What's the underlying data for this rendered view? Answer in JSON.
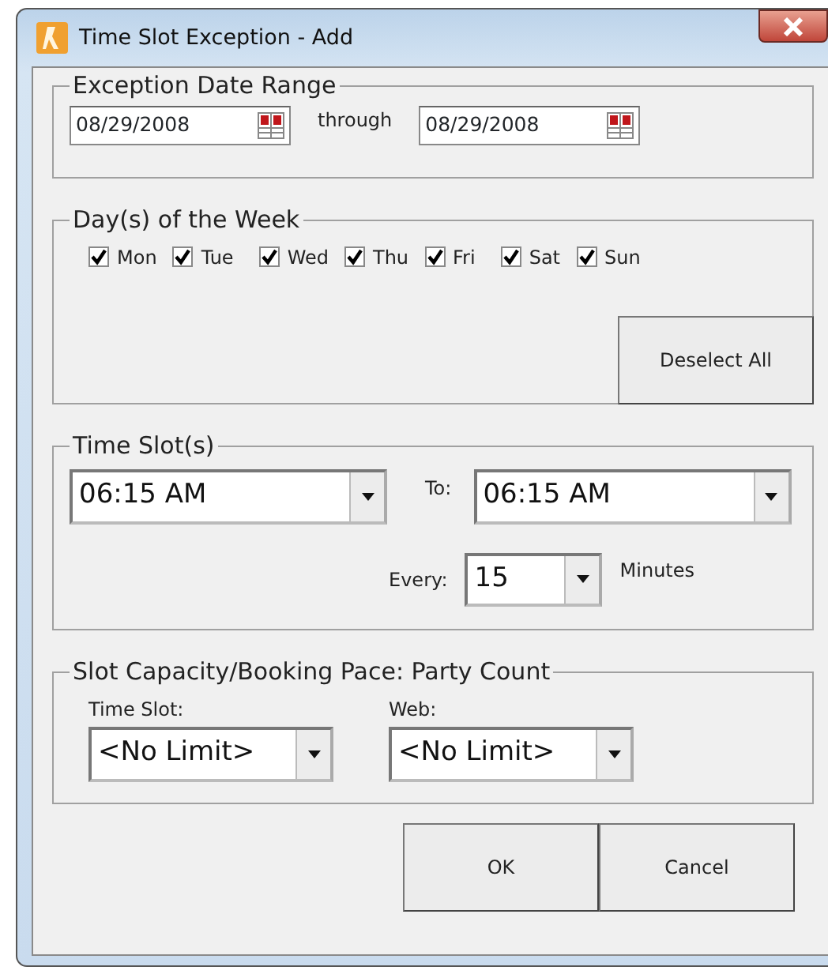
{
  "window": {
    "title": "Time Slot Exception - Add"
  },
  "date_range": {
    "legend": "Exception Date Range",
    "from": "08/29/2008",
    "through_label": "through",
    "to": "08/29/2008"
  },
  "days": {
    "legend": "Day(s) of the Week",
    "items": [
      {
        "label": "Mon",
        "checked": true
      },
      {
        "label": "Tue",
        "checked": true
      },
      {
        "label": "Wed",
        "checked": true
      },
      {
        "label": "Thu",
        "checked": true
      },
      {
        "label": "Fri",
        "checked": true
      },
      {
        "label": "Sat",
        "checked": true
      },
      {
        "label": "Sun",
        "checked": true
      }
    ],
    "deselect_button": "Deselect All"
  },
  "time_slots": {
    "legend": "Time Slot(s)",
    "from": "06:15 AM",
    "to_label": "To:",
    "to": "06:15 AM",
    "every_label": "Every:",
    "every": "15",
    "unit_label": "Minutes"
  },
  "capacity": {
    "legend": "Slot Capacity/Booking Pace: Party Count",
    "time_slot_label": "Time Slot:",
    "time_slot": "<No Limit>",
    "web_label": "Web:",
    "web": "<No Limit>"
  },
  "buttons": [
    "OK",
    "Cancel"
  ]
}
